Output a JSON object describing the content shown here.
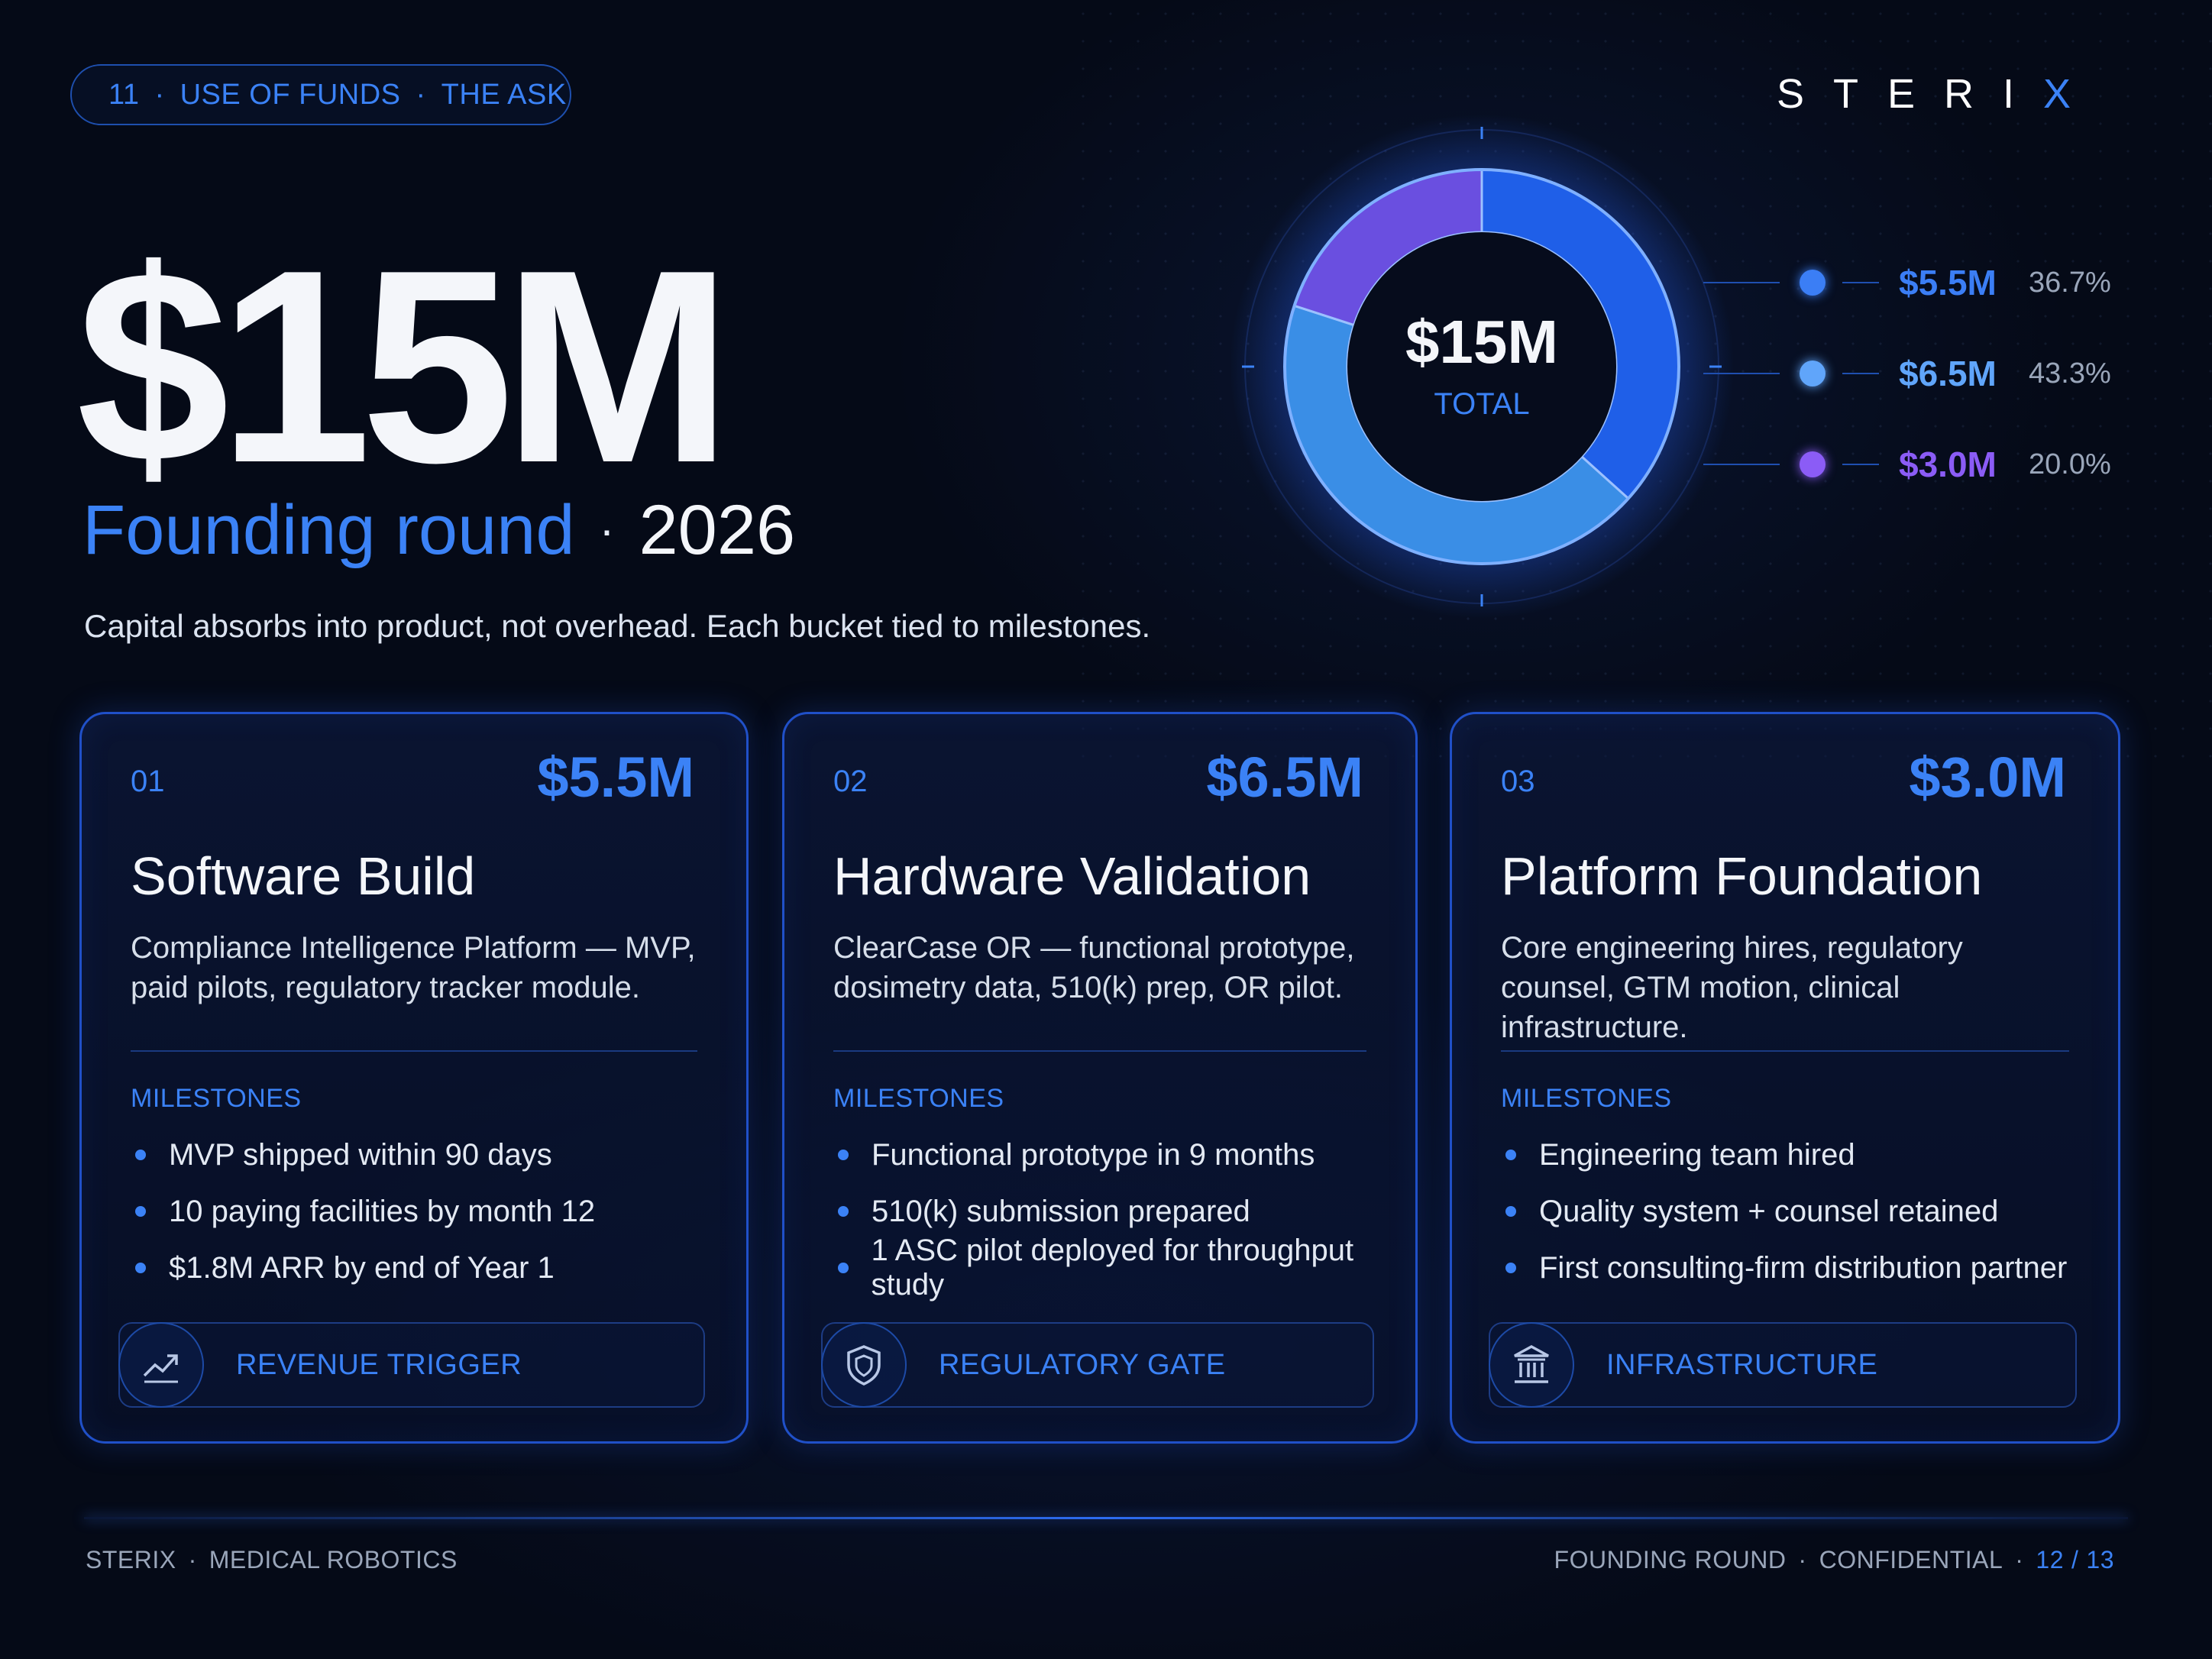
{
  "header": {
    "slide_number": "11",
    "section": "USE OF FUNDS",
    "subsection": "THE ASK",
    "separator": "·",
    "brand_main": "STERI",
    "brand_x": "X"
  },
  "hero": {
    "amount": "$15M",
    "round": "Founding round",
    "dot": "·",
    "year": "2026",
    "tagline": "Capital absorbs into product, not overhead.  Each bucket tied to milestones."
  },
  "chart_data": {
    "type": "pie",
    "center_value": "$15M",
    "center_label": "TOTAL",
    "slices": [
      {
        "label": "$5.5M",
        "value": 5.5,
        "percent": "36.7%",
        "color": "#1f5fe8",
        "dot": "#3b7ef5"
      },
      {
        "label": "$6.5M",
        "value": 6.5,
        "percent": "43.3%",
        "color": "#3a8ee6",
        "dot": "#60a5fa"
      },
      {
        "label": "$3.0M",
        "value": 3.0,
        "percent": "20.0%",
        "color": "#6a4fe0",
        "dot": "#8b5cf6"
      }
    ]
  },
  "cards": [
    {
      "num": "01",
      "amount": "$5.5M",
      "title": "Software Build",
      "desc": "Compliance Intelligence Platform — MVP, paid pilots, regulatory tracker module.",
      "milestones_label": "MILESTONES",
      "milestones": [
        "MVP shipped within 90 days",
        "10 paying facilities by month 12",
        "$1.8M ARR by end of Year 1"
      ],
      "footer_icon": "trending-up-icon",
      "footer_label": "REVENUE TRIGGER"
    },
    {
      "num": "02",
      "amount": "$6.5M",
      "title": "Hardware Validation",
      "desc": "ClearCase OR — functional prototype, dosimetry data, 510(k) prep, OR pilot.",
      "milestones_label": "MILESTONES",
      "milestones": [
        "Functional prototype in 9 months",
        "510(k) submission prepared",
        "1 ASC pilot deployed for throughput study"
      ],
      "footer_icon": "shield-icon",
      "footer_label": "REGULATORY GATE"
    },
    {
      "num": "03",
      "amount": "$3.0M",
      "title": "Platform Foundation",
      "desc": "Core engineering hires, regulatory counsel, GTM motion, clinical infrastructure.",
      "milestones_label": "MILESTONES",
      "milestones": [
        "Engineering team hired",
        "Quality system + counsel retained",
        "First consulting-firm distribution partner"
      ],
      "footer_icon": "bank-building-icon",
      "footer_label": "INFRASTRUCTURE"
    }
  ],
  "footer": {
    "company": "STERIX",
    "division": "MEDICAL ROBOTICS",
    "round": "FOUNDING ROUND",
    "confidential": "CONFIDENTIAL",
    "page_current": "12",
    "page_sep": "/",
    "page_total": "13",
    "dot": "·"
  }
}
